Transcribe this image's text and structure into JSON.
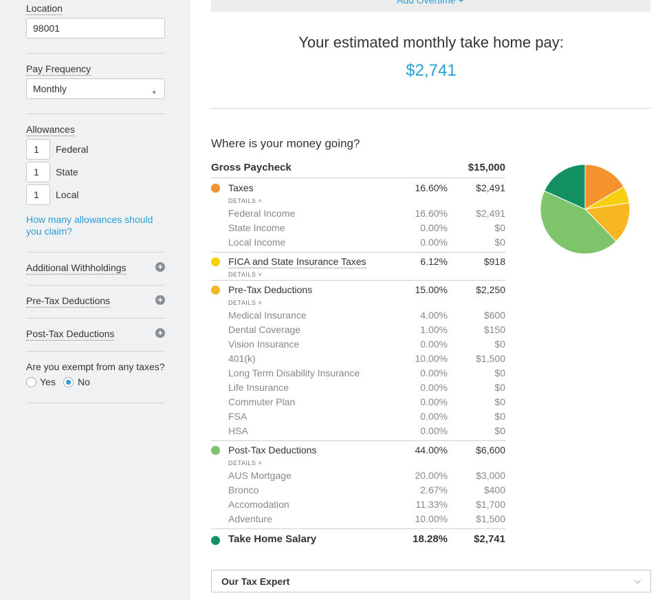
{
  "sidebar": {
    "location_label": "Location",
    "location_value": "98001",
    "pay_frequency_label": "Pay Frequency",
    "pay_frequency_value": "Monthly",
    "allowances_label": "Allowances",
    "allowances": [
      {
        "value": "1",
        "label": "Federal"
      },
      {
        "value": "1",
        "label": "State"
      },
      {
        "value": "1",
        "label": "Local"
      }
    ],
    "allowances_help_link": "How many allowances should you claim?",
    "sections": [
      {
        "label": "Additional Withholdings"
      },
      {
        "label": "Pre-Tax Deductions"
      },
      {
        "label": "Post-Tax Deductions"
      }
    ],
    "exempt_question": "Are you exempt from any taxes?",
    "exempt_yes": "Yes",
    "exempt_no": "No",
    "exempt_selected": "No"
  },
  "main": {
    "overtime_link": "Add Overtime +",
    "estimate_title": "Your estimated monthly take home pay:",
    "estimate_value": "$2,741",
    "where_title": "Where is your money going?",
    "gross_label": "Gross Paycheck",
    "gross_amount": "$15,000",
    "details_label": "DETAILS",
    "groups": [
      {
        "name": "Taxes",
        "pct": "16.60%",
        "amount": "$2,491",
        "color": "#f4922d",
        "expanded": true,
        "items": [
          {
            "name": "Federal Income",
            "pct": "16.60%",
            "amount": "$2,491"
          },
          {
            "name": "State Income",
            "pct": "0.00%",
            "amount": "$0"
          },
          {
            "name": "Local Income",
            "pct": "0.00%",
            "amount": "$0"
          }
        ]
      },
      {
        "name": "FICA and State Insurance Taxes",
        "pct": "6.12%",
        "amount": "$918",
        "color": "#f7cf10",
        "expanded": false,
        "items": []
      },
      {
        "name": "Pre-Tax Deductions",
        "pct": "15.00%",
        "amount": "$2,250",
        "color": "#f6b722",
        "expanded": true,
        "items": [
          {
            "name": "Medical Insurance",
            "pct": "4.00%",
            "amount": "$600"
          },
          {
            "name": "Dental Coverage",
            "pct": "1.00%",
            "amount": "$150"
          },
          {
            "name": "Vision Insurance",
            "pct": "0.00%",
            "amount": "$0"
          },
          {
            "name": "401(k)",
            "pct": "10.00%",
            "amount": "$1,500"
          },
          {
            "name": "Long Term Disability Insurance",
            "pct": "0.00%",
            "amount": "$0"
          },
          {
            "name": "Life Insurance",
            "pct": "0.00%",
            "amount": "$0"
          },
          {
            "name": "Commuter Plan",
            "pct": "0.00%",
            "amount": "$0"
          },
          {
            "name": "FSA",
            "pct": "0.00%",
            "amount": "$0"
          },
          {
            "name": "HSA",
            "pct": "0.00%",
            "amount": "$0"
          }
        ]
      },
      {
        "name": "Post-Tax Deductions",
        "pct": "44.00%",
        "amount": "$6,600",
        "color": "#7ec46a",
        "expanded": true,
        "items": [
          {
            "name": "AUS Mortgage",
            "pct": "20.00%",
            "amount": "$3,000"
          },
          {
            "name": "Bronco",
            "pct": "2.67%",
            "amount": "$400"
          },
          {
            "name": "Accomodation",
            "pct": "11.33%",
            "amount": "$1,700"
          },
          {
            "name": "Adventure",
            "pct": "10.00%",
            "amount": "$1,500"
          }
        ]
      }
    ],
    "take_home": {
      "name": "Take Home Salary",
      "pct": "18.28%",
      "amount": "$2,741",
      "color": "#149163"
    },
    "tax_expert_label": "Our Tax Expert"
  },
  "chart_data": {
    "type": "pie",
    "categories": [
      "Taxes",
      "FICA and State Insurance Taxes",
      "Pre-Tax Deductions",
      "Post-Tax Deductions",
      "Take Home Salary"
    ],
    "values": [
      16.6,
      6.12,
      15.0,
      44.0,
      18.28
    ],
    "colors": [
      "#f4922d",
      "#f7cf10",
      "#f6b722",
      "#7ec46a",
      "#149163"
    ]
  }
}
